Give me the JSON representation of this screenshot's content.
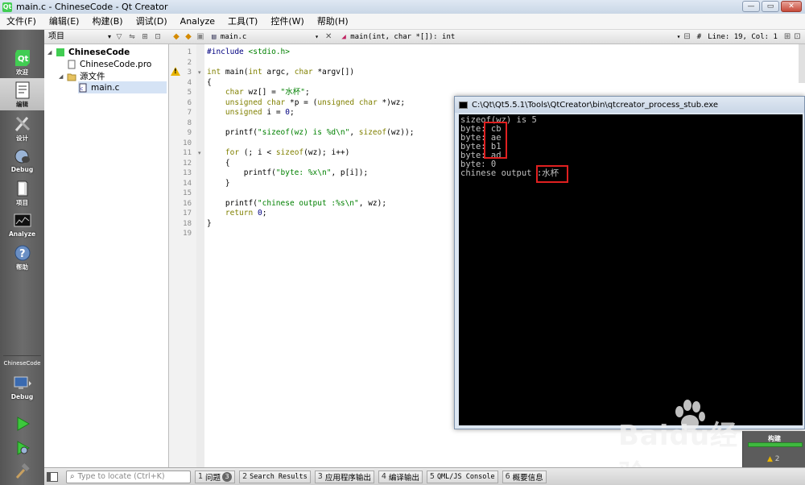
{
  "window": {
    "title": "main.c - ChineseCode - Qt Creator",
    "controls": {
      "minimize": "—",
      "maximize": "▭",
      "close": "✕"
    }
  },
  "menu": [
    "文件(F)",
    "编辑(E)",
    "构建(B)",
    "调试(D)",
    "Analyze",
    "工具(T)",
    "控件(W)",
    "帮助(H)"
  ],
  "modes": [
    {
      "label": "欢迎",
      "icon": "qt-logo-icon"
    },
    {
      "label": "编辑",
      "icon": "edit-document-icon"
    },
    {
      "label": "设计",
      "icon": "design-tools-icon"
    },
    {
      "label": "Debug",
      "icon": "debug-bug-icon"
    },
    {
      "label": "项目",
      "icon": "projects-icon"
    },
    {
      "label": "Analyze",
      "icon": "analyze-icon"
    },
    {
      "label": "帮助",
      "icon": "help-icon"
    }
  ],
  "target_selector": {
    "project": "ChineseCode",
    "mode": "Debug"
  },
  "project_panel": {
    "view_select": "项目",
    "tree": [
      {
        "label": "ChineseCode",
        "type": "project",
        "bold": true
      },
      {
        "label": "ChineseCode.pro",
        "type": "pro"
      },
      {
        "label": "源文件",
        "type": "folder"
      },
      {
        "label": "main.c",
        "type": "c-file",
        "selected": true
      }
    ]
  },
  "editor_toolbar": {
    "file": "main.c",
    "function": "main(int, char *[]): int",
    "hash": "#",
    "line_col": "Line: 19, Col: 1"
  },
  "editor": {
    "line_numbers": [
      "1",
      "2",
      "3",
      "4",
      "5",
      "6",
      "7",
      "8",
      "9",
      "10",
      "11",
      "12",
      "13",
      "14",
      "15",
      "16",
      "17",
      "18",
      "19"
    ],
    "code": [
      "#include <stdio.h>",
      "",
      "int main(int argc, char *argv[])",
      "{",
      "    char wz[] = \"水杯\";",
      "    unsigned char *p = (unsigned char *)wz;",
      "    unsigned i = 0;",
      "",
      "    printf(\"sizeof(wz) is %d\\n\", sizeof(wz));",
      "",
      "    for (; i < sizeof(wz); i++)",
      "    {",
      "        printf(\"byte: %x\\n\", p[i]);",
      "    }",
      "",
      "    printf(\"chinese output :%s\\n\", wz);",
      "    return 0;",
      "}",
      ""
    ]
  },
  "console": {
    "title": "C:\\Qt\\Qt5.5.1\\Tools\\QtCreator\\bin\\qtcreator_process_stub.exe",
    "lines": [
      "sizeof(wz) is 5",
      "byte: cb",
      "byte: ae",
      "byte: b1",
      "byte: ad",
      "byte: 0",
      "chinese output :水杯"
    ]
  },
  "build": {
    "label": "构建",
    "progress": 1.0,
    "warnings": "2"
  },
  "statusbar": {
    "locator_placeholder": "Type to locate (Ctrl+K)",
    "panes": [
      {
        "num": "1",
        "label": "问题",
        "badge": "3"
      },
      {
        "num": "2",
        "label": "Search Results"
      },
      {
        "num": "3",
        "label": "应用程序输出"
      },
      {
        "num": "4",
        "label": "编译输出"
      },
      {
        "num": "5",
        "label": "QML/JS Console"
      },
      {
        "num": "6",
        "label": "概要信息"
      }
    ]
  },
  "watermark": {
    "brand": "Baidu经验",
    "url": "jingyan.baidu.com"
  },
  "colors": {
    "highlight_box": "#e02020",
    "console_bg": "#000000",
    "console_fg": "#c0c0c0"
  }
}
